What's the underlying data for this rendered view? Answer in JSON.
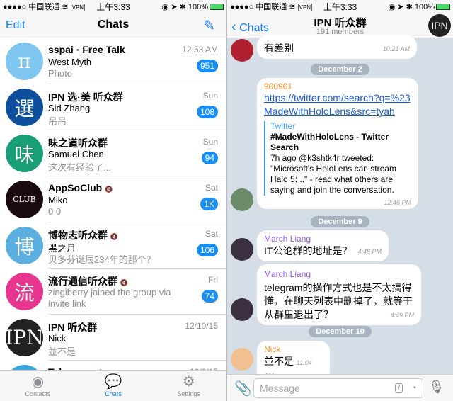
{
  "status": {
    "carrier": "●●●●○ 中国联通",
    "vpn": "VPN",
    "time": "上午3:33",
    "battery": "100%"
  },
  "left": {
    "edit": "Edit",
    "title": "Chats",
    "compose_icon": "compose-icon",
    "chats": [
      {
        "name": "sspai · Free Talk",
        "time": "12:53 AM",
        "sender": "West Myth",
        "preview": "Photo",
        "badge": "951",
        "avatar": "π",
        "color": "#7fc6f0",
        "muted": false
      },
      {
        "name": "IPN 选·美 听众群",
        "time": "Sun",
        "sender": "Sid Zhang",
        "preview": "吊吊",
        "badge": "108",
        "avatar": "選",
        "color": "#0d4f9c",
        "muted": false
      },
      {
        "name": "味之道听众群",
        "time": "Sun",
        "sender": "Samuel Chen",
        "preview": "这次有经验了...",
        "badge": "94",
        "avatar": "味",
        "color": "#1a9e77",
        "muted": false
      },
      {
        "name": "AppSoClub",
        "time": "Sat",
        "sender": "Miko",
        "preview": "0 0",
        "badge": "1K",
        "avatar": "CLUB",
        "color": "#1a0a0e",
        "muted": true
      },
      {
        "name": "博物志听众群",
        "time": "Sat",
        "sender": "黑之月",
        "preview": "贝多芬诞辰234年的那个？",
        "badge": "106",
        "avatar": "博",
        "color": "#5aaee0",
        "muted": true
      },
      {
        "name": "流行通信听众群",
        "time": "Fri",
        "sender": "",
        "preview": "zingiberry joined the group via invite link",
        "badge": "74",
        "avatar": "流",
        "color": "#e8358f",
        "muted": true
      },
      {
        "name": "IPN 听众群",
        "time": "12/10/15",
        "sender": "Nick",
        "preview": "並不是",
        "badge": "",
        "avatar": "IPN",
        "color": "#222",
        "muted": false
      },
      {
        "name": "Telegram",
        "time": "12/9/15",
        "sender": "",
        "preview": "",
        "badge": "",
        "avatar": "",
        "color": "#3aa5e0",
        "muted": false
      }
    ],
    "tabs": [
      {
        "label": "Contacts",
        "icon": "person-icon"
      },
      {
        "label": "Chats",
        "icon": "chat-bubbles-icon",
        "active": true
      },
      {
        "label": "Settings",
        "icon": "gear-icon"
      }
    ]
  },
  "right": {
    "back": "Chats",
    "title": "IPN 听众群",
    "subtitle": "191 members",
    "avatar": "IPN",
    "messages": [
      {
        "text": "有差别",
        "time": "10:21 AM"
      },
      {
        "date": "December 2"
      },
      {
        "sender": "900901",
        "sender_color": "#f08a24",
        "link": "https://twitter.com/search?q=%23MadeWithHoloLens&src=tyah",
        "preview_site": "Twitter",
        "preview_title": "#MadeWithHoloLens - Twitter Search",
        "preview_body": "7h ago @k3shtk4r tweeted: \"Microsoft's HoloLens can stream Halo 5: ..\" - read what others are saying and join the conversation.",
        "time": "12:46 PM"
      },
      {
        "date": "December 9"
      },
      {
        "sender": "March Liang",
        "sender_color": "#8e5fe0",
        "text": "IT公论群的地址是？",
        "time": "4:48 PM"
      },
      {
        "sender": "March Liang",
        "sender_color": "#8e5fe0",
        "text": "telegram的操作方式也是不太搞得懂，在聊天列表中删掉了，就等于从群里退出了？",
        "time": "4:49 PM"
      },
      {
        "date": "December 10"
      },
      {
        "sender": "Nick",
        "sender_color": "#f08a24",
        "text": "並不是",
        "time": "11:04 AM"
      }
    ],
    "input_placeholder": "Message"
  }
}
